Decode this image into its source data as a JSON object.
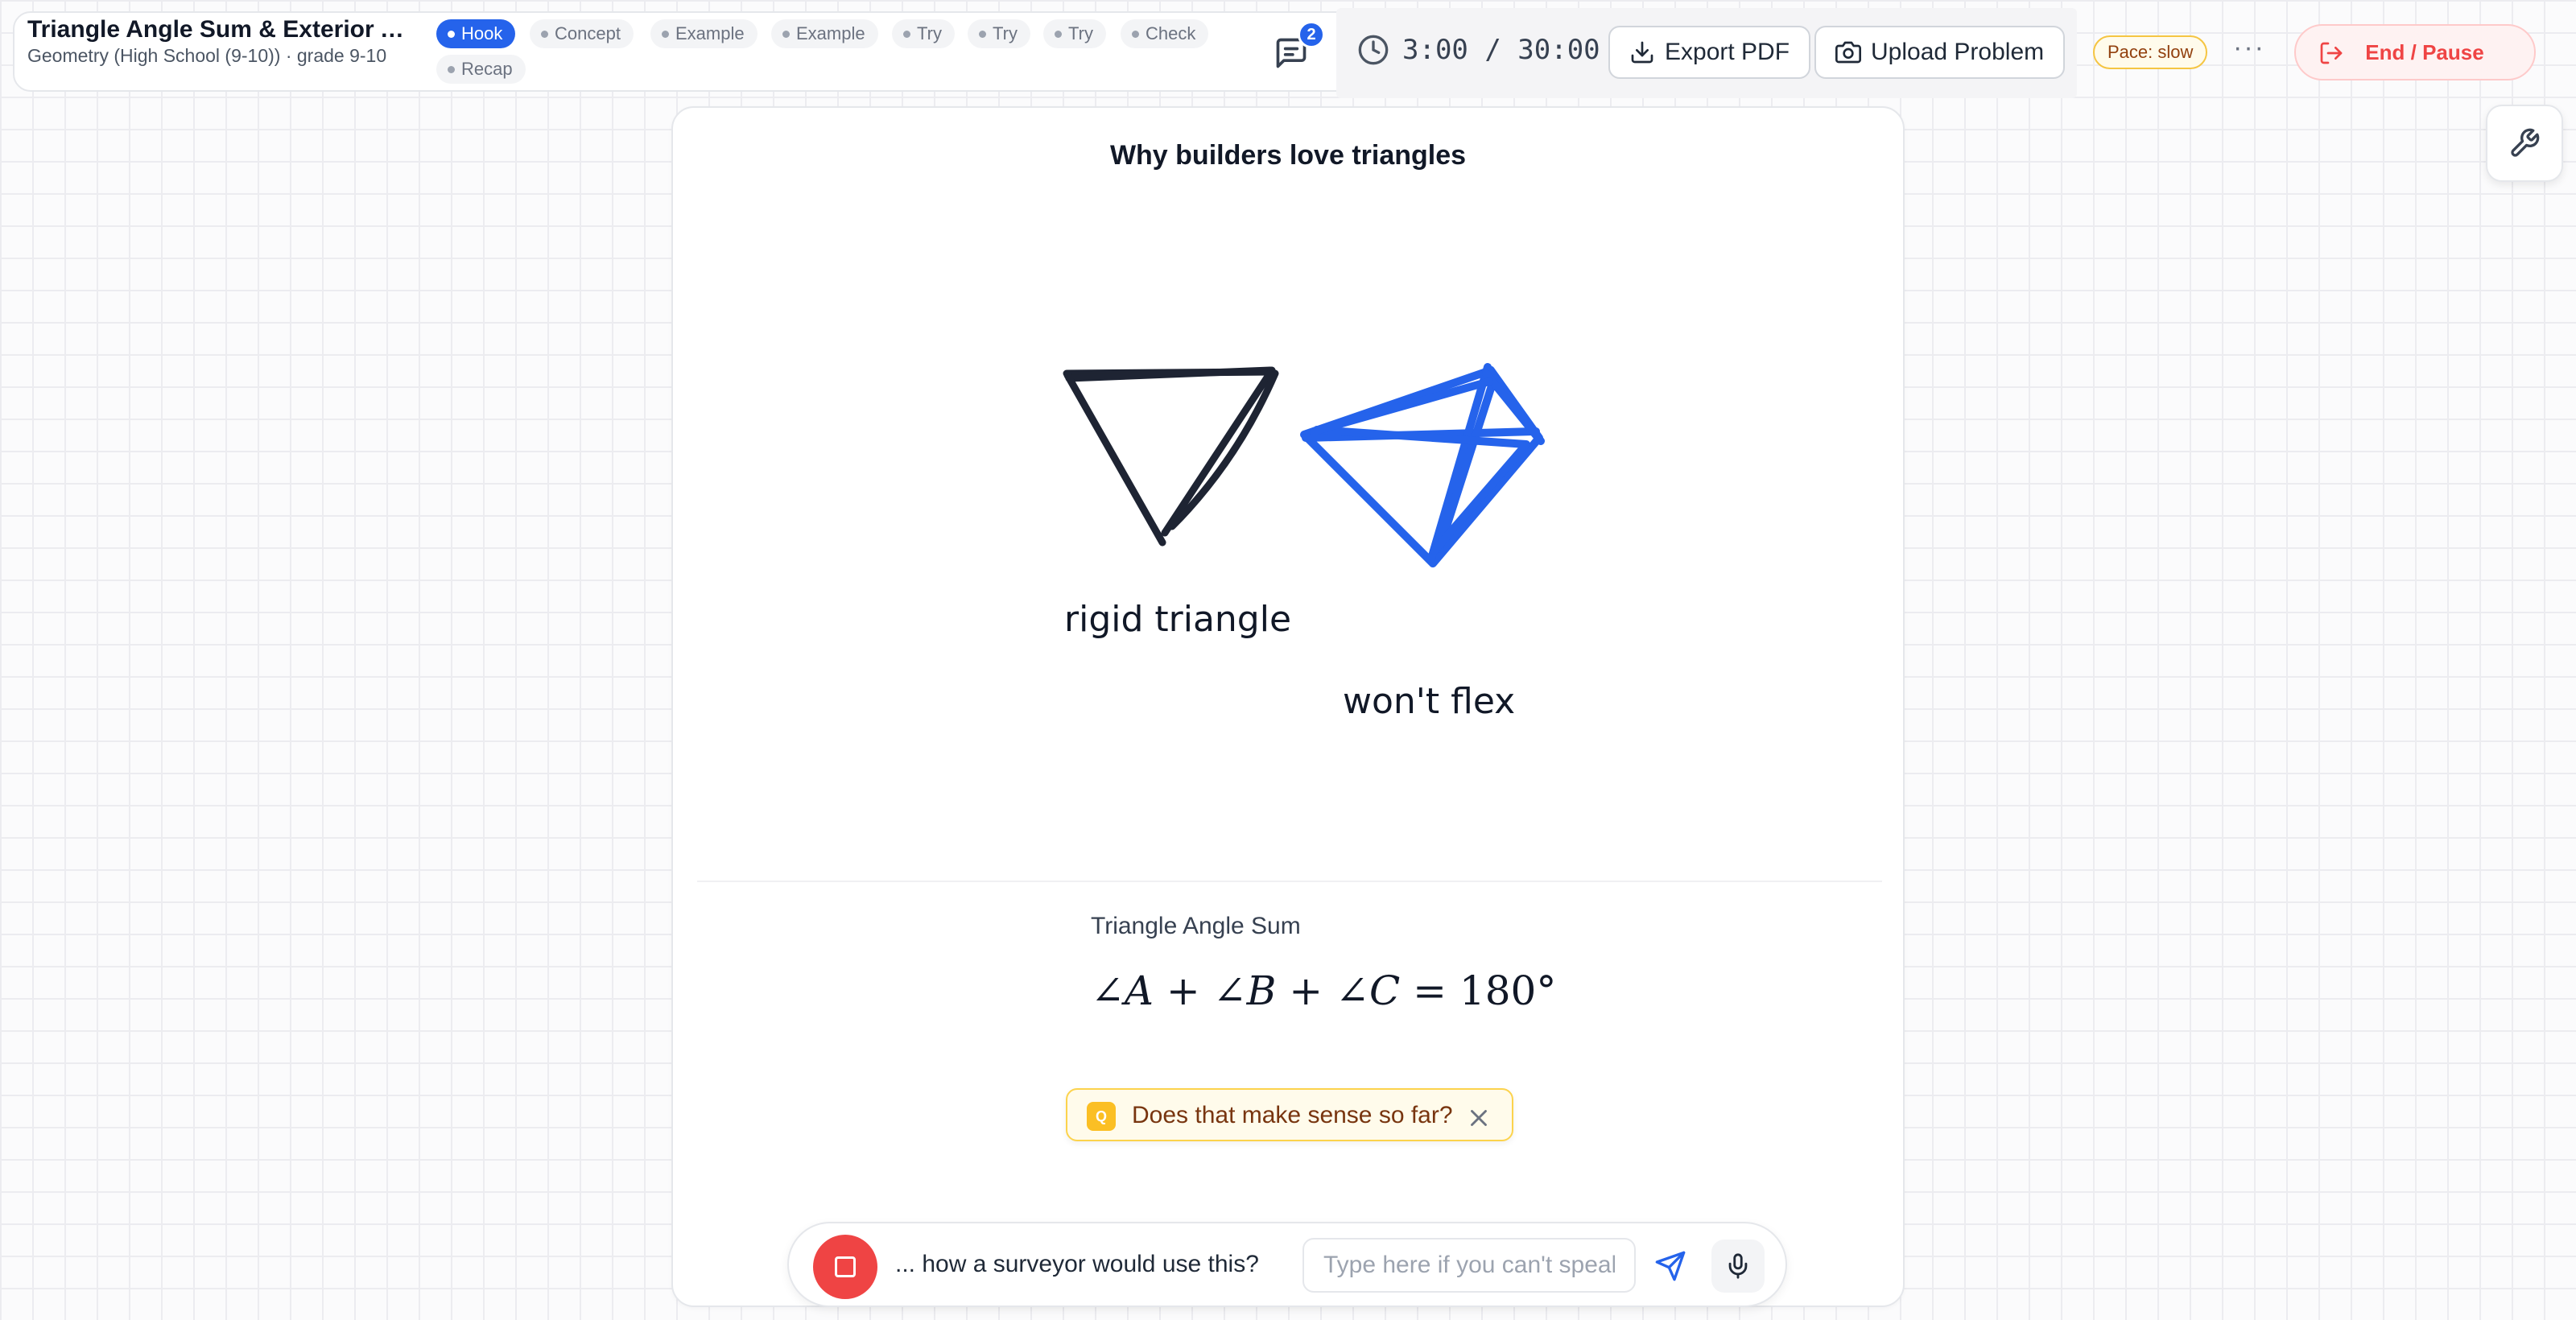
{
  "header": {
    "title": "Triangle Angle Sum & Exterior A...",
    "subtitle": "Geometry (High School (9-10)) · grade 9-10",
    "steps": [
      {
        "label": "Hook",
        "active": true
      },
      {
        "label": "Concept",
        "active": false
      },
      {
        "label": "Example",
        "active": false
      },
      {
        "label": "Example",
        "active": false
      },
      {
        "label": "Try",
        "active": false
      },
      {
        "label": "Try",
        "active": false
      },
      {
        "label": "Try",
        "active": false
      },
      {
        "label": "Check",
        "active": false
      },
      {
        "label": "Recap",
        "active": false
      }
    ],
    "chat_badge_count": "2",
    "timer": "3:00 / 30:00",
    "export_label": "Export PDF",
    "upload_label": "Upload Problem",
    "pace": "Pace: slow",
    "more_label": "···",
    "end_label": "End / Pause"
  },
  "board": {
    "title": "Why builders love triangles",
    "label_rigid": "rigid triangle",
    "label_flex": "won't flex",
    "formula_label": "Triangle Angle Sum",
    "formula": {
      "a1": "∠",
      "v1": "A",
      "p1": " + ",
      "a2": "∠",
      "v2": "B",
      "p2": " + ",
      "a3": "∠",
      "v3": "C",
      "eq": " = 180°"
    },
    "colors": {
      "ink": "#1e2433",
      "blue": "#2563eb"
    }
  },
  "check_popup": {
    "badge": "Q",
    "text": "Does that make sense so far?"
  },
  "input_bar": {
    "transcript": "... how a surveyor would use this?",
    "placeholder": "Type here if you can't speak",
    "value": ""
  },
  "icons": [
    "chat-icon",
    "clock-icon",
    "download-icon",
    "camera-icon",
    "logout-icon",
    "wrench-icon",
    "close-icon",
    "stop-icon",
    "send-icon",
    "mic-icon"
  ]
}
